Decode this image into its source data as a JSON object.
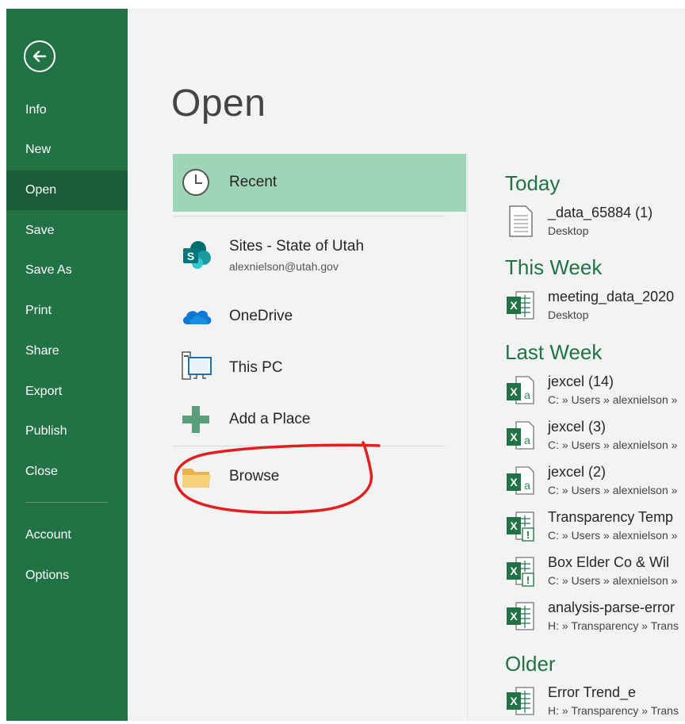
{
  "colors": {
    "sidebar": "#217346",
    "sidebar_active": "#1a5c38",
    "main_bg": "#f3f3f3",
    "recent_highlight": "#9fd5b7",
    "group_heading": "#217346",
    "annotation": "#e02020"
  },
  "sidebar": {
    "back_icon": "back-arrow-icon",
    "items": [
      {
        "label": "Info"
      },
      {
        "label": "New"
      },
      {
        "label": "Open",
        "active": true
      },
      {
        "label": "Save"
      },
      {
        "label": "Save As"
      },
      {
        "label": "Print"
      },
      {
        "label": "Share"
      },
      {
        "label": "Export"
      },
      {
        "label": "Publish"
      },
      {
        "label": "Close"
      }
    ],
    "bottom_items": [
      {
        "label": "Account"
      },
      {
        "label": "Options"
      }
    ]
  },
  "main": {
    "title": "Open",
    "locations": {
      "recent": {
        "label": "Recent",
        "icon": "clock-icon"
      },
      "sites": {
        "label": "Sites - State of Utah",
        "sublabel": "alexnielson@utah.gov",
        "icon": "sharepoint-icon"
      },
      "onedrive": {
        "label": "OneDrive",
        "icon": "cloud-icon"
      },
      "thispc": {
        "label": "This PC",
        "icon": "computer-icon"
      },
      "addplace": {
        "label": "Add a Place",
        "icon": "plus-icon"
      },
      "browse": {
        "label": "Browse",
        "icon": "folder-icon"
      }
    },
    "groups": {
      "today": "Today",
      "this_week": "This Week",
      "last_week": "Last Week",
      "older": "Older"
    },
    "files": {
      "f1": {
        "name": "_data_65884 (1)",
        "path": "Desktop",
        "icon": "text-file-icon"
      },
      "f2": {
        "name": "meeting_data_2020",
        "path": "Desktop",
        "icon": "excel-icon"
      },
      "f3": {
        "name": "jexcel (14)",
        "path": "C: » Users » alexnielson »",
        "icon": "excel-addin-icon"
      },
      "f4": {
        "name": "jexcel (3)",
        "path": "C: » Users » alexnielson »",
        "icon": "excel-addin-icon"
      },
      "f5": {
        "name": "jexcel (2)",
        "path": "C: » Users » alexnielson »",
        "icon": "excel-addin-icon"
      },
      "f6": {
        "name": "Transparency Temp",
        "path": "C: » Users » alexnielson »",
        "icon": "excel-warning-icon"
      },
      "f7": {
        "name": "Box Elder Co & Wil",
        "path": "C: » Users » alexnielson »",
        "icon": "excel-warning-icon"
      },
      "f8": {
        "name": "analysis-parse-error",
        "path": "H: » Transparency » Trans",
        "icon": "excel-icon"
      },
      "f9": {
        "name": "Error Trend_e",
        "path": "H: » Transparency » Trans",
        "icon": "excel-icon"
      }
    }
  }
}
